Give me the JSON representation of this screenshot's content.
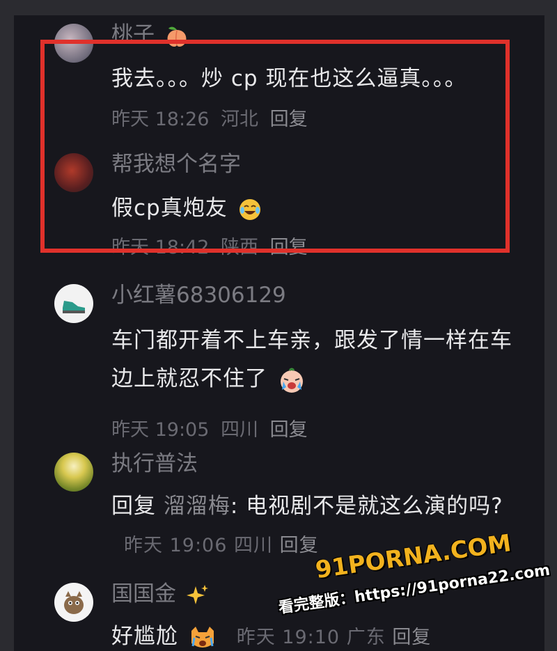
{
  "comments": [
    {
      "user": "桃子",
      "text": "我去。。。炒 cp 现在也这么逼真。。。",
      "time": "昨天 18:26",
      "region": "河北",
      "reply": "回复"
    },
    {
      "user": "帮我想个名字",
      "text": "假cp真炮友",
      "time": "昨天 18:42",
      "region": "陕西",
      "reply": "回复"
    },
    {
      "user": "小红薯68306129",
      "text": "车门都开着不上车亲，跟发了情一样在车边上就忍不住了",
      "time": "昨天 19:05",
      "region": "四川",
      "reply": "回复"
    },
    {
      "user": "执行普法",
      "reply_prefix": "回复",
      "reply_target": "溜溜梅",
      "text": ": 电视剧不是就这么演的吗?",
      "time": "昨天 19:06",
      "region": "四川",
      "reply": "回复"
    },
    {
      "user": "国国金",
      "text": "好尴尬",
      "time": "昨天 19:10",
      "region": "广东",
      "reply": "回复"
    }
  ],
  "watermark": {
    "logo": "91PORNA.COM",
    "url": "看完整版：https://91porna22.com"
  },
  "colors": {
    "highlight": "#e0312b",
    "background": "#17171d"
  }
}
